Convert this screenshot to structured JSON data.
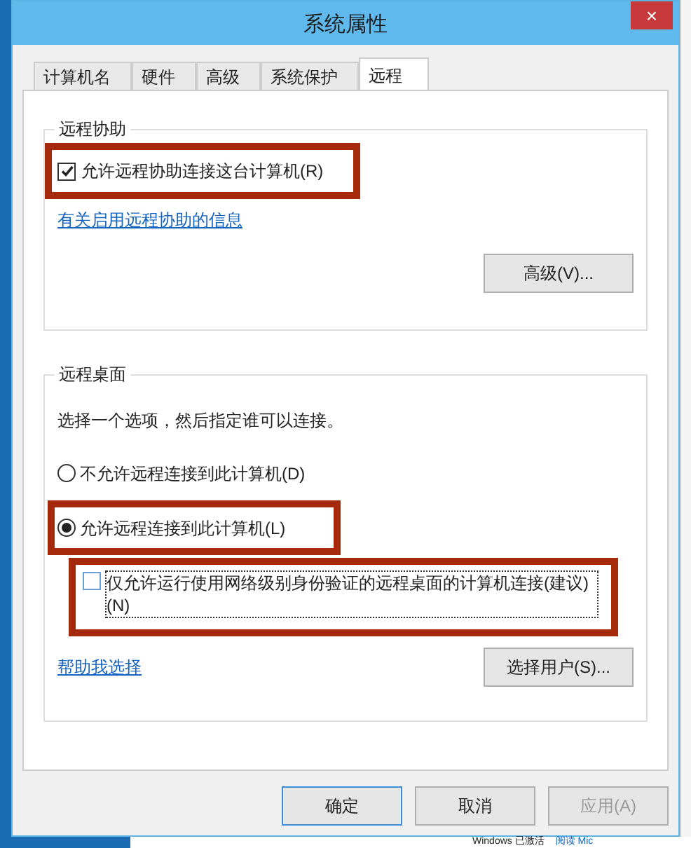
{
  "window": {
    "title": "系统属性",
    "close": "×"
  },
  "tabs": [
    {
      "label": "计算机名",
      "selected": false
    },
    {
      "label": "硬件",
      "selected": false
    },
    {
      "label": "高级",
      "selected": false
    },
    {
      "label": "系统保护",
      "selected": false
    },
    {
      "label": "远程",
      "selected": true
    }
  ],
  "remote_assistance": {
    "title": "远程协助",
    "allow": {
      "label": "允许远程协助连接这台计算机(R)",
      "checked": true,
      "annotated": true
    },
    "link": "有关启用远程协助的信息",
    "button": "高级(V)..."
  },
  "remote_desktop": {
    "title": "远程桌面",
    "hint": "选择一个选项，然后指定谁可以连接。",
    "options": [
      {
        "label": "不允许远程连接到此计算机(D)",
        "selected": false,
        "annotated": false
      },
      {
        "label": "允许远程连接到此计算机(L)",
        "selected": true,
        "annotated": true
      }
    ],
    "nla": {
      "label": "仅允许运行使用网络级别身份验证的远程桌面的计算机连接(建议)(N)",
      "checked": false,
      "annotated": true
    },
    "link": "帮助我选择",
    "button": "选择用户(S)..."
  },
  "buttons": [
    {
      "label": "确定",
      "default": true,
      "disabled": false
    },
    {
      "label": "取消",
      "default": false,
      "disabled": false
    },
    {
      "label": "应用(A)",
      "default": false,
      "disabled": true
    }
  ],
  "desktop_status": {
    "text": "Windows 已激活",
    "link": "阅读 Mic"
  }
}
